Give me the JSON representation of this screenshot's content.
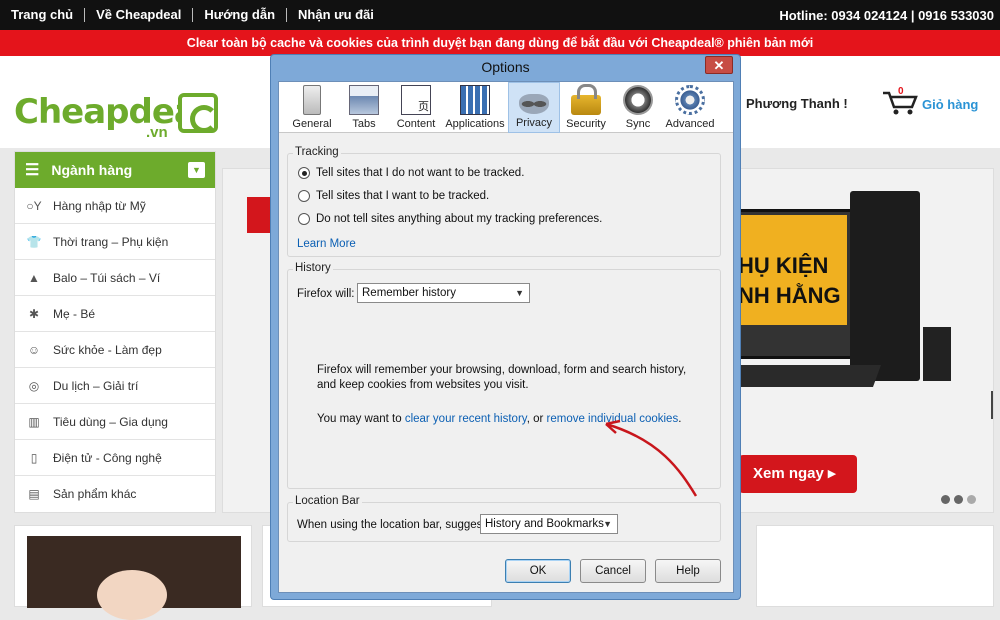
{
  "site": {
    "nav": [
      "Trang chủ",
      "Về Cheapdeal",
      "Hướng dẫn",
      "Nhận ưu đãi"
    ],
    "hotline": "Hotline: 0934 024124 | 0916 533030",
    "banner": "Clear toàn bộ cache và cookies của trình duyệt bạn đang dùng để bắt đầu với Cheapdeal® phiên bản mới",
    "logo_text": "Cheapdeal",
    "logo_suffix": ".vn",
    "greeting": "Phương Thanh !",
    "cart_label": "Giỏ hàng",
    "cart_count": "0",
    "sidebar_title": "Ngành hàng",
    "categories": [
      {
        "label": "Hàng nhập từ Mỹ",
        "icon": "import-icon"
      },
      {
        "label": "Thời trang – Phụ kiện",
        "icon": "shirt-icon"
      },
      {
        "label": "Balo – Túi sách – Ví",
        "icon": "bag-icon"
      },
      {
        "label": "Mẹ - Bé",
        "icon": "stroller-icon"
      },
      {
        "label": "Sức khỏe - Làm đẹp",
        "icon": "smile-icon"
      },
      {
        "label": "Du lịch – Giải trí",
        "icon": "steering-icon"
      },
      {
        "label": "Tiêu dùng – Gia dụng",
        "icon": "map-icon"
      },
      {
        "label": "Điện tử - Công nghệ",
        "icon": "phone-icon"
      },
      {
        "label": "Sản phẩm khác",
        "icon": "box-icon"
      }
    ],
    "slider_title_1": "HỤ KIỆN",
    "slider_title_2": "NH HẰNG",
    "slider_button": "Xem ngay ▸"
  },
  "dialog": {
    "title": "Options",
    "close": "✕",
    "tabs": [
      {
        "label": "General",
        "icon": "general-icon"
      },
      {
        "label": "Tabs",
        "icon": "tabs-icon"
      },
      {
        "label": "Content",
        "icon": "content-icon"
      },
      {
        "label": "Applications",
        "icon": "applications-icon"
      },
      {
        "label": "Privacy",
        "icon": "privacy-icon",
        "active": true
      },
      {
        "label": "Security",
        "icon": "security-icon"
      },
      {
        "label": "Sync",
        "icon": "sync-icon"
      },
      {
        "label": "Advanced",
        "icon": "advanced-icon"
      }
    ],
    "tracking": {
      "label": "Tracking",
      "options": [
        "Tell sites that I do not want to be tracked.",
        "Tell sites that I want to be tracked.",
        "Do not tell sites anything about my tracking preferences."
      ],
      "selected": 0,
      "learn_more": "Learn More"
    },
    "history": {
      "label": "History",
      "will_label": "Firefox will:",
      "will_value": "Remember history",
      "desc": "Firefox will remember your browsing, download, form and search history, and keep cookies from websites you visit.",
      "may_prefix": "You may want to",
      "clear_link": "clear your recent history",
      "or_text": ", or",
      "remove_link": "remove individual cookies",
      "period": "."
    },
    "location": {
      "label": "Location Bar",
      "suggest_label": "When using the location bar, suggest:",
      "suggest_value": "History and Bookmarks"
    },
    "buttons": {
      "ok": "OK",
      "cancel": "Cancel",
      "help": "Help"
    }
  }
}
